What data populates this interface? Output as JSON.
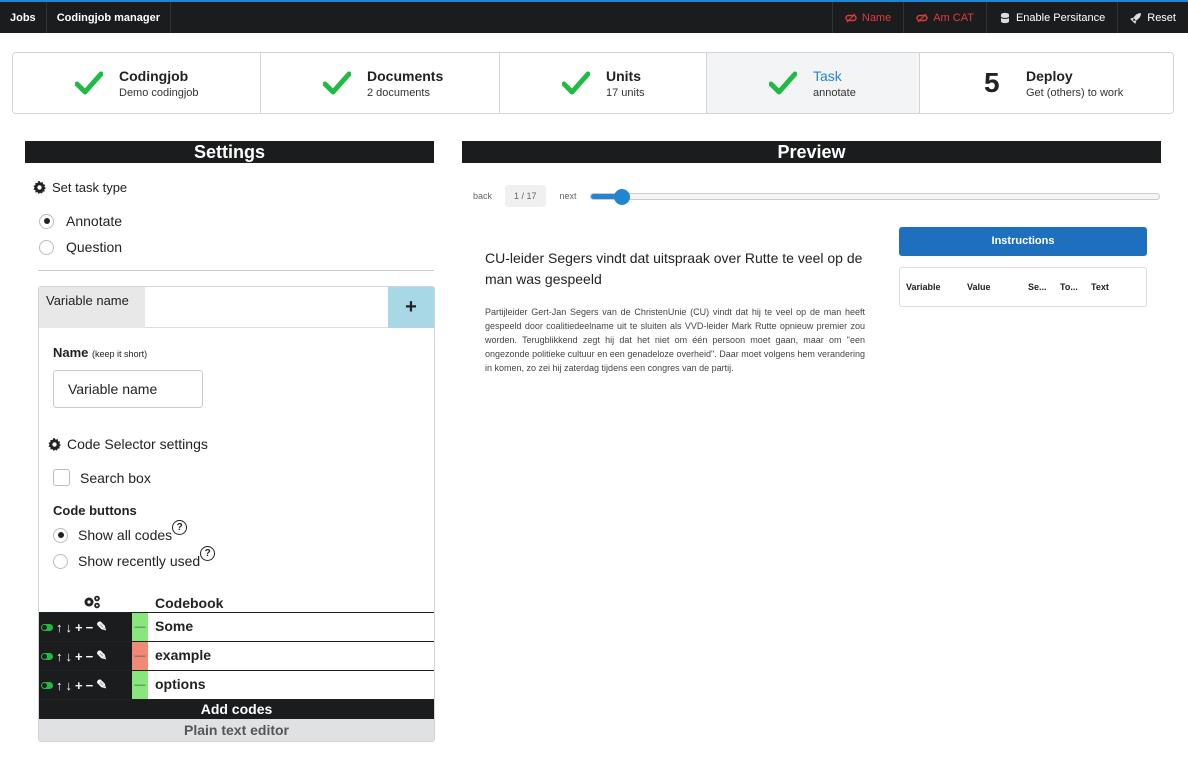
{
  "topbar": {
    "items": [
      "Jobs",
      "Codingjob manager"
    ],
    "right": [
      {
        "label": "Name",
        "icon": "no-user-icon",
        "color": "#e03c3c"
      },
      {
        "label": "Am CAT",
        "icon": "no-user-icon",
        "color": "#e03c3c"
      },
      {
        "label": "Enable Persitance",
        "icon": "database-icon",
        "color": "#ffffff"
      },
      {
        "label": "Reset",
        "icon": "rocket-icon",
        "color": "#ffffff"
      }
    ]
  },
  "steps": [
    {
      "title": "Codingjob",
      "desc": "Demo codingjob",
      "done": true
    },
    {
      "title": "Documents",
      "desc": "2 documents",
      "done": true
    },
    {
      "title": "Units",
      "desc": "17 units",
      "done": true
    },
    {
      "title": "Task",
      "desc": "annotate",
      "done": true,
      "active": true
    },
    {
      "title": "Deploy",
      "desc": "Get (others) to work",
      "number": "5"
    }
  ],
  "settings": {
    "header": "Settings",
    "task_type_label": "Set task type",
    "task_types": [
      {
        "label": "Annotate",
        "selected": true
      },
      {
        "label": "Question",
        "selected": false
      }
    ],
    "variable_tab": "Variable name",
    "add_label": "+",
    "name_label": "Name",
    "name_hint": "(keep it short)",
    "name_value": "Variable name",
    "code_selector_label": "Code Selector settings",
    "search_box_label": "Search box",
    "code_buttons_label": "Code buttons",
    "code_button_options": [
      {
        "label": "Show all codes",
        "selected": true
      },
      {
        "label": "Show recently used",
        "selected": false
      }
    ],
    "help_glyph": "?",
    "codebook_label": "Codebook",
    "codes": [
      {
        "code": "Some",
        "color": "#88e67c"
      },
      {
        "code": "example",
        "color": "#f08a74"
      },
      {
        "code": "options",
        "color": "#88e67c"
      }
    ],
    "add_codes": "Add codes",
    "plain_editor": "Plain text editor"
  },
  "preview": {
    "header": "Preview",
    "back": "back",
    "count": "1 / 17",
    "next": "next",
    "progress": 0.04,
    "article_title": "CU-leider Segers vindt dat uitspraak over Rutte te veel op de man was gespeeld",
    "article_body": "Partijleider Gert-Jan Segers van de ChristenUnie (CU) vindt dat hij te veel op de man heeft gespeeld door coalitiedeelname uit te sluiten als VVD-leider Mark Rutte opnieuw premier zou worden. Terugblikkend zegt hij dat het niet om één persoon moet gaan, maar om \"een ongezonde politieke cultuur en een genadeloze overheid\". Daar moet volgens hem verandering in komen, zo zei hij zaterdag tijdens een congres van de partij.",
    "instructions": "Instructions",
    "table_headers": [
      "Variable",
      "Value",
      "Se...",
      "To...",
      "Text"
    ]
  }
}
